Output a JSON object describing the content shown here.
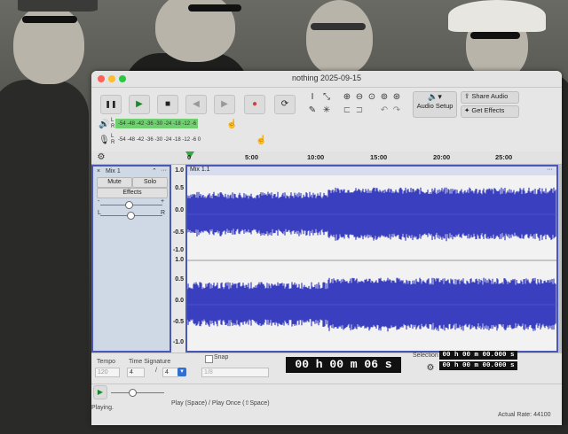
{
  "window": {
    "title": "nothing 2025-09-15"
  },
  "toolbar": {
    "transport": {
      "pause": "❚❚",
      "play": "▶",
      "stop": "■",
      "skip_start": "◀",
      "skip_end": "▶",
      "record": "●",
      "loop": "⟳"
    },
    "audio_setup_label": "Audio Setup",
    "share_audio_label": "Share Audio",
    "get_effects_label": "Get Effects",
    "playback_meter": {
      "channels": "L\nR",
      "ticks": "-54 -48 -42 -36 -30 -24 -18 -12 -6"
    },
    "record_meter": {
      "channels": "L\nR",
      "ticks": "-54 -48 -42 -36 -30 -24 -18 -12 -6 0"
    }
  },
  "ruler": {
    "ticks": [
      "0",
      "5:00",
      "10:00",
      "15:00",
      "20:00",
      "25:00"
    ]
  },
  "track": {
    "name": "Mix 1",
    "close": "×",
    "collapse": "⌃",
    "menu": "···",
    "mute_label": "Mute",
    "solo_label": "Solo",
    "effects_label": "Effects",
    "gain_minus": "-",
    "gain_plus": "+",
    "pan_left": "L",
    "pan_right": "R"
  },
  "clip": {
    "name": "Mix 1.1",
    "menu": "···"
  },
  "scale": {
    "upper": [
      "1.0",
      "0.5",
      "0.0",
      "-0.5",
      "-1.0"
    ],
    "lower": [
      "1.0",
      "0.5",
      "0.0",
      "-0.5",
      "-1.0"
    ]
  },
  "bottom": {
    "tempo_label": "Tempo",
    "tempo_value": "120",
    "time_sig_label": "Time Signature",
    "time_sig_num": "4",
    "time_sig_slash": "/",
    "time_sig_den": "4",
    "snap_label": "Snap",
    "snap_value": "1/8",
    "time_display": "00 h 00 m 06 s",
    "selection_label": "Selection",
    "selection_start": "00 h 00 m 00.000 s",
    "selection_end": "00 h 00 m 00.000 s",
    "status_text": "Play (Space) / Play Once (⇧Space)",
    "playing_text": "Playing.",
    "rate_text": "Actual Rate: 44100"
  },
  "colors": {
    "waveform": "#3a3fbf",
    "selection_border": "#4a58b8",
    "meter_green": "#6fd06f"
  }
}
